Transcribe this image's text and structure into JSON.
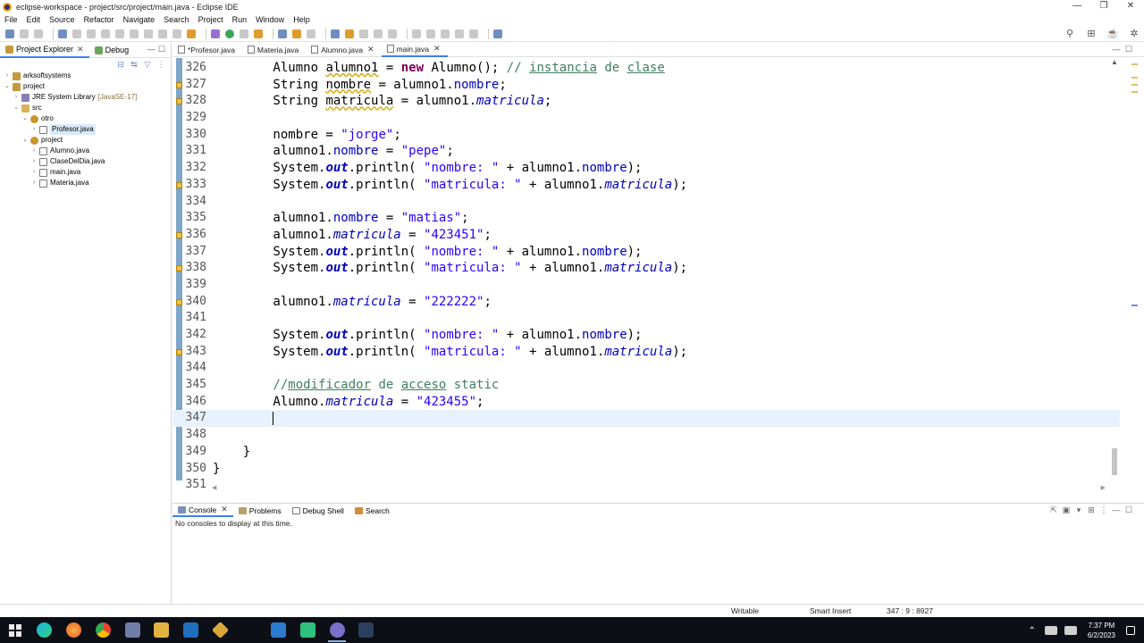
{
  "window": {
    "title": "eclipse-workspace - project/src/project/main.java - Eclipse IDE",
    "controls": [
      "—",
      "❐",
      "✕"
    ]
  },
  "menu": [
    "File",
    "Edit",
    "Source",
    "Refactor",
    "Navigate",
    "Search",
    "Project",
    "Run",
    "Window",
    "Help"
  ],
  "left_panel": {
    "tabs": [
      {
        "label": "Project Explorer",
        "close": "✕"
      },
      {
        "label": "Debug"
      }
    ],
    "controls": [
      "—",
      "☐"
    ],
    "tree": [
      {
        "label": "arksoftsystems",
        "depth": 0,
        "arrow": "›",
        "icon": "project-icon"
      },
      {
        "label": "project",
        "depth": 0,
        "arrow": "⌄",
        "icon": "project-icon"
      },
      {
        "label": "JRE System Library",
        "suffix": "[JavaSE-17]",
        "depth": 1,
        "arrow": "›",
        "icon": "library-icon"
      },
      {
        "label": "src",
        "depth": 1,
        "arrow": "⌄",
        "icon": "source-folder-icon"
      },
      {
        "label": "otro",
        "depth": 2,
        "arrow": "⌄",
        "icon": "package-icon"
      },
      {
        "label": "Profesor.java",
        "depth": 3,
        "arrow": "›",
        "icon": "java-file-icon",
        "selected": true
      },
      {
        "label": "project",
        "depth": 2,
        "arrow": "⌄",
        "icon": "package-icon"
      },
      {
        "label": "Alumno.java",
        "depth": 3,
        "arrow": "›",
        "icon": "java-file-icon"
      },
      {
        "label": "ClaseDelDia.java",
        "depth": 3,
        "arrow": "›",
        "icon": "java-file-icon"
      },
      {
        "label": "main.java",
        "depth": 3,
        "arrow": "›",
        "icon": "java-file-icon"
      },
      {
        "label": "Materia.java",
        "depth": 3,
        "arrow": "›",
        "icon": "java-file-icon"
      }
    ]
  },
  "editor": {
    "tabs": [
      {
        "label": "*Profesor.java",
        "active": false
      },
      {
        "label": "Materia.java",
        "active": false
      },
      {
        "label": "Alumno.java",
        "active": false,
        "close": "✕"
      },
      {
        "label": "main.java",
        "active": true,
        "close": "✕"
      }
    ],
    "controls": [
      "—",
      "☐"
    ],
    "current_line": 347,
    "lines": [
      {
        "n": "326",
        "html": "        Alumno <span class=\"warnul\">alumno1</span> = <span class=\"kw\">new</span> Alumno(); <span class=\"com\">// <span class=\"ul\">instancia</span> de <span class=\"ul\">clase</span></span>"
      },
      {
        "n": "327",
        "html": "        String <span class=\"warnul\">nombre</span> = alumno1.<span class=\"fld\">nombre</span>;",
        "marker": true
      },
      {
        "n": "328",
        "html": "        String <span class=\"warnul\">matricula</span> = alumno1.<span class=\"ifld\">matricula</span>;",
        "marker": true
      },
      {
        "n": "329",
        "html": ""
      },
      {
        "n": "330",
        "html": "        nombre = <span class=\"str\">\"jorge\"</span>;"
      },
      {
        "n": "331",
        "html": "        alumno1.<span class=\"fld\">nombre</span> = <span class=\"str\">\"pepe\"</span>;"
      },
      {
        "n": "332",
        "html": "        System.<span class=\"sfld\">out</span>.println( <span class=\"str\">\"nombre: \"</span> + alumno1.<span class=\"fld\">nombre</span>);"
      },
      {
        "n": "333",
        "html": "        System.<span class=\"sfld\">out</span>.println( <span class=\"str\">\"matricula: \"</span> + alumno1.<span class=\"ifld\">matricula</span>);",
        "marker": true
      },
      {
        "n": "334",
        "html": ""
      },
      {
        "n": "335",
        "html": "        alumno1.<span class=\"fld\">nombre</span> = <span class=\"str\">\"matias\"</span>;"
      },
      {
        "n": "336",
        "html": "        alumno1.<span class=\"ifld\">matricula</span> = <span class=\"str\">\"423451\"</span>;",
        "marker": true
      },
      {
        "n": "337",
        "html": "        System.<span class=\"sfld\">out</span>.println( <span class=\"str\">\"nombre: \"</span> + alumno1.<span class=\"fld\">nombre</span>);"
      },
      {
        "n": "338",
        "html": "        System.<span class=\"sfld\">out</span>.println( <span class=\"str\">\"matricula: \"</span> + alumno1.<span class=\"ifld\">matricula</span>);",
        "marker": true
      },
      {
        "n": "339",
        "html": ""
      },
      {
        "n": "340",
        "html": "        alumno1.<span class=\"ifld\">matricula</span> = <span class=\"str\">\"222222\"</span>;",
        "marker": true
      },
      {
        "n": "341",
        "html": ""
      },
      {
        "n": "342",
        "html": "        System.<span class=\"sfld\">out</span>.println( <span class=\"str\">\"nombre: \"</span> + alumno1.<span class=\"fld\">nombre</span>);"
      },
      {
        "n": "343",
        "html": "        System.<span class=\"sfld\">out</span>.println( <span class=\"str\">\"matricula: \"</span> + alumno1.<span class=\"ifld\">matricula</span>);",
        "marker": true
      },
      {
        "n": "344",
        "html": ""
      },
      {
        "n": "345",
        "html": "        <span class=\"com\">//<span class=\"ul\">modificador</span> de <span class=\"ul\">acceso</span> static</span>"
      },
      {
        "n": "346",
        "html": "        Alumno.<span class=\"ifld\">matricula</span> = <span class=\"str\">\"423455\"</span>;"
      },
      {
        "n": "347",
        "html": "        <span class=\"caret\"></span>",
        "current": true
      },
      {
        "n": "348",
        "html": ""
      },
      {
        "n": "349",
        "html": "    }"
      },
      {
        "n": "350",
        "html": "}"
      },
      {
        "n": "351",
        "html": ""
      }
    ]
  },
  "console": {
    "tabs": [
      {
        "label": "Console",
        "active": true,
        "close": "✕"
      },
      {
        "label": "Problems"
      },
      {
        "label": "Debug Shell"
      },
      {
        "label": "Search"
      }
    ],
    "message": "No consoles to display at this time."
  },
  "status": {
    "writable": "Writable",
    "insert_mode": "Smart Insert",
    "position": "347 : 9 : 8927"
  },
  "taskbar": {
    "time": "7:37 PM",
    "date": "6/2/2023"
  }
}
